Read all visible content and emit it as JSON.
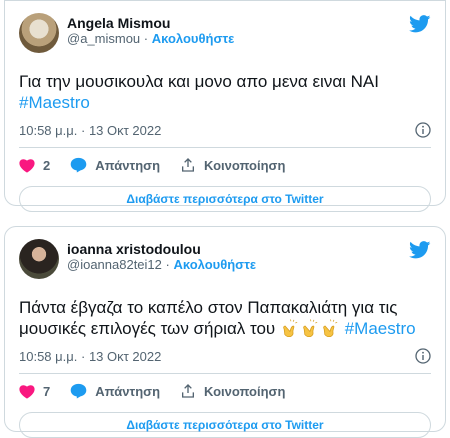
{
  "tweets": [
    {
      "name": "Angela Mismou",
      "handle": "@a_mismou",
      "separator": "·",
      "follow": "Ακολουθήστε",
      "text": "Για την μουσικουλα και μονο απο μενα ειναι ΝΑΙ",
      "hashtag": "#Maestro",
      "time": "10:58 μ.μ.",
      "date_sep": "·",
      "date": "13 Οκτ 2022",
      "likes": "2",
      "reply": "Απάντηση",
      "share": "Κοινοποίηση",
      "readmore": "Διαβάστε περισσότερα στο Twitter"
    },
    {
      "name": "ioanna xristodoulou",
      "handle": "@ioanna82tei12",
      "separator": "·",
      "follow": "Ακολουθήστε",
      "text_line1": "Πάντα έβγαζα το καπέλο στον Παπακαλιάτη για τις",
      "text_line2": "μουσικές επιλογές των σήριαλ του",
      "hashtag": "#Maestro",
      "time": "10:58 μ.μ.",
      "date_sep": "·",
      "date": "13 Οκτ 2022",
      "likes": "7",
      "reply": "Απάντηση",
      "share": "Κοινοποίηση",
      "readmore": "Διαβάστε περισσότερα στο Twitter"
    }
  ],
  "colors": {
    "accent": "#1d9bf0",
    "heart": "#f91880",
    "text": "#0f1419",
    "muted": "#536471"
  },
  "icons": [
    "twitter-bird-icon",
    "info-icon",
    "heart-icon",
    "reply-bubble-icon",
    "share-icon",
    "clap-emoji-icon"
  ]
}
